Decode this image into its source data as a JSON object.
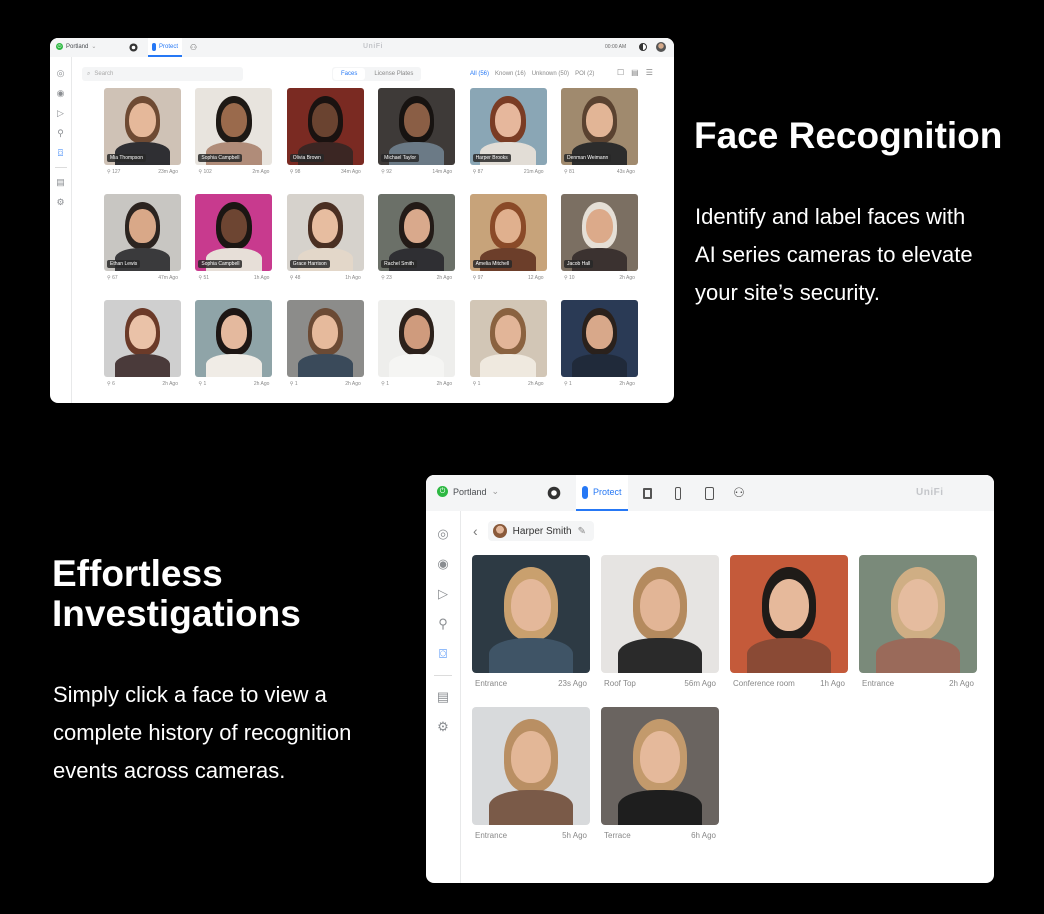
{
  "section1": {
    "heading": "Face Recognition",
    "body_lines": [
      "Identify and label faces with",
      "AI series cameras to elevate",
      "your site’s security."
    ]
  },
  "section2": {
    "heading_lines": [
      "Effortless",
      "Investigations"
    ],
    "body_lines": [
      "Simply click a face to view a",
      "complete history of recognition",
      "events across cameras."
    ]
  },
  "window1": {
    "site": "Portland",
    "protect_tab": "Protect",
    "brand": "UniFi",
    "clock": "00:00 AM",
    "search_placeholder": "Search",
    "segments": [
      "Faces",
      "License Plates"
    ],
    "filters": [
      "All (56)",
      "Known (16)",
      "Unknown (50)",
      "POI (2)"
    ],
    "faces": [
      {
        "name": "Mia Thompson",
        "count": "127",
        "ago": "23m Ago",
        "bg": "#cfc2b6",
        "skin": "#e5b89a",
        "hair": "#6e4a33",
        "shirt": "#2f2f33"
      },
      {
        "name": "Sophia Campbell",
        "count": "102",
        "ago": "2m Ago",
        "bg": "#e8e4de",
        "skin": "#9a6a4c",
        "hair": "#1e1915",
        "shirt": "#b08c79"
      },
      {
        "name": "Olivia Brown",
        "count": "98",
        "ago": "34m Ago",
        "bg": "#7a2a22",
        "skin": "#6a4330",
        "hair": "#1a1210",
        "shirt": "#3b2623"
      },
      {
        "name": "Michael Taylor",
        "count": "92",
        "ago": "14m Ago",
        "bg": "#3e3a38",
        "skin": "#8a5e45",
        "hair": "#171311",
        "shirt": "#6b7a86"
      },
      {
        "name": "Harper Brooks",
        "count": "87",
        "ago": "21m Ago",
        "bg": "#8aa6b5",
        "skin": "#e6b79c",
        "hair": "#7a3c24",
        "shirt": "#e2ddd6"
      },
      {
        "name": "Denman Weimann",
        "count": "81",
        "ago": "43s Ago",
        "bg": "#a08a6e",
        "skin": "#e2b596",
        "hair": "#5a4230",
        "shirt": "#2c2c2c"
      },
      {
        "name": "Ethan Lewis",
        "count": "67",
        "ago": "47m Ago",
        "bg": "#c8c6c2",
        "skin": "#d9a888",
        "hair": "#2c2420",
        "shirt": "#3a3a3c"
      },
      {
        "name": "Sophia Campbell",
        "count": "51",
        "ago": "1h Ago",
        "bg": "#c83a8e",
        "skin": "#6d4532",
        "hair": "#1b1613",
        "shirt": "#e7dfd8"
      },
      {
        "name": "Grace Harrison",
        "count": "48",
        "ago": "1h Ago",
        "bg": "#d6d2cc",
        "skin": "#e7bda0",
        "hair": "#4a2f22",
        "shirt": "#e3d7c9"
      },
      {
        "name": "Rachel Smith",
        "count": "23",
        "ago": "2h Ago",
        "bg": "#6b7068",
        "skin": "#d9a98c",
        "hair": "#231b17",
        "shirt": "#2f2f33"
      },
      {
        "name": "Amelia Mitchell",
        "count": "97",
        "ago": "12 Ago",
        "bg": "#c7a37a",
        "skin": "#e0b08e",
        "hair": "#8a4a28",
        "shirt": "#6c3e2a"
      },
      {
        "name": "Jacob Hall",
        "count": "10",
        "ago": "2h Ago",
        "bg": "#7b6f62",
        "skin": "#dcaa8a",
        "hair": "#e5dfd6",
        "shirt": "#3b3230"
      },
      {
        "name": "",
        "count": "6",
        "ago": "2h Ago",
        "bg": "#cfcfcf",
        "skin": "#eac2a8",
        "hair": "#6b3a28",
        "shirt": "#4a3a3a"
      },
      {
        "name": "",
        "count": "1",
        "ago": "2h Ago",
        "bg": "#8fa4a8",
        "skin": "#e4b99e",
        "hair": "#1d1614",
        "shirt": "#f0ece6"
      },
      {
        "name": "",
        "count": "1",
        "ago": "2h Ago",
        "bg": "#8c8c8a",
        "skin": "#e6ba9c",
        "hair": "#6b4a34",
        "shirt": "#3a4a5a"
      },
      {
        "name": "",
        "count": "1",
        "ago": "2h Ago",
        "bg": "#eeeeec",
        "skin": "#cf9b7d",
        "hair": "#2c211b",
        "shirt": "#f5f5f3"
      },
      {
        "name": "",
        "count": "1",
        "ago": "2h Ago",
        "bg": "#d2c6b6",
        "skin": "#e2b598",
        "hair": "#8a6240",
        "shirt": "#efe9df"
      },
      {
        "name": "",
        "count": "1",
        "ago": "2h Ago",
        "bg": "#2a3a55",
        "skin": "#d8a88a",
        "hair": "#2a211c",
        "shirt": "#202a3a"
      }
    ]
  },
  "window2": {
    "site": "Portland",
    "protect_tab": "Protect",
    "brand": "UniFi",
    "person_name": "Harper Smith",
    "events": [
      {
        "camera": "Entrance",
        "ago": "23s Ago",
        "bg": "#2d3a44",
        "skin": "#e4b89a",
        "hair": "#c9a06e",
        "shirt": "#3f5466"
      },
      {
        "camera": "Roof Top",
        "ago": "56m Ago",
        "bg": "#e6e4e2",
        "skin": "#e2b596",
        "hair": "#b48a5e",
        "shirt": "#2a2a2a"
      },
      {
        "camera": "Conference room",
        "ago": "1h Ago",
        "bg": "#c45a3a",
        "skin": "#e6b99b",
        "hair": "#1f1b18",
        "shirt": "#8a4a35"
      },
      {
        "camera": "Entrance",
        "ago": "2h Ago",
        "bg": "#7a8a7a",
        "skin": "#e5bc9f",
        "hair": "#cfae84",
        "shirt": "#9a6a5a"
      },
      {
        "camera": "Entrance",
        "ago": "5h Ago",
        "bg": "#d8dadc",
        "skin": "#e3b797",
        "hair": "#b98f63",
        "shirt": "#7a5a48"
      },
      {
        "camera": "Terrace",
        "ago": "6h Ago",
        "bg": "#6a6460",
        "skin": "#e5b99b",
        "hair": "#c39a6c",
        "shirt": "#1e1e1e"
      }
    ]
  }
}
